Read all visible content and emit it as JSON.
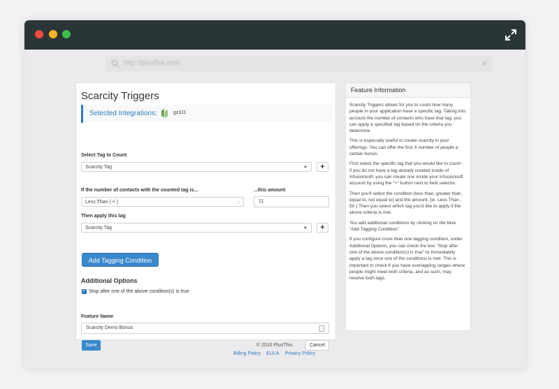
{
  "address_bar": {
    "url": "http://plusthis.com"
  },
  "form": {
    "title": "Scarcity Triggers",
    "selected_integrations_label": "Selected Integrations:",
    "integration_name": "gz311",
    "tag_to_count_label": "Select Tag to Count",
    "tag_to_count_value": "Scarcity Tag",
    "condition_label": "If the number of contacts with the counted tag is...",
    "condition_value": "Less Than ( < )",
    "amount_label": "...this amount",
    "amount_value": "11",
    "apply_tag_label": "Then apply this tag",
    "apply_tag_value": "Scarcity Tag",
    "add_condition_button": "Add Tagging Condition",
    "additional_options_title": "Additional Options",
    "stop_checkbox_label": "Stop after one of the above condition(s) is true",
    "stop_checkbox_checked": true,
    "feature_name_label": "Feature Name",
    "feature_name_value": "Scarcity Demo Bonus",
    "save_button": "Save",
    "cancel_button": "Cancel",
    "plus_symbol": "+"
  },
  "feature_info": {
    "title": "Feature Information",
    "paragraphs": [
      "Scarcity Triggers allows for you to count how many people in your application have a specific tag. Taking into account the number of contacts who have that tag, you can apply a specified tag based on the criteria you determine.",
      "This is especially useful to create scarcity in your offerings. You can offer the first X number of people a certain bonus.",
      "First select the specific tag that you would like to count - if you do not have a tag already created inside of Infusionsoft, you can create one inside your Infusionsoft account by using the \"+\" button next to field selector.",
      "Then you'll select the condition (less than, greater than, equal to, not equal to) and the amount. (ie. Less Than , 50 ) Then you select which tag you'd like to apply if the above criteria is met.",
      "You add additional conditions by clicking on the blue \"Add Tagging Condition\".",
      "If you configure more than one tagging condition, under Additional Options, you can check the box \"Stop after one of the above condition(s) is true\" to immediately apply a tag once one of the conditions is met. This is important to check if you have overlapping ranges where people might meet both criteria, and as such, may receive both tags."
    ]
  },
  "footer": {
    "copyright": "© 2016 PlusThis.",
    "links": [
      "Billing Policy",
      "EULA",
      "Privacy Policy"
    ]
  },
  "colors": {
    "titlebar": "#2a3538",
    "accent": "#3a88cc",
    "close": "#ef4b3f",
    "minimize": "#f5b422",
    "maximize": "#3cc04c"
  },
  "icons": [
    "close-dot",
    "minimize-dot",
    "maximize-dot",
    "expand-icon",
    "search-icon",
    "heart-icon",
    "integration-logo-icon",
    "caret-down-icon",
    "plus-icon",
    "checkbox-checked-icon",
    "document-icon"
  ]
}
